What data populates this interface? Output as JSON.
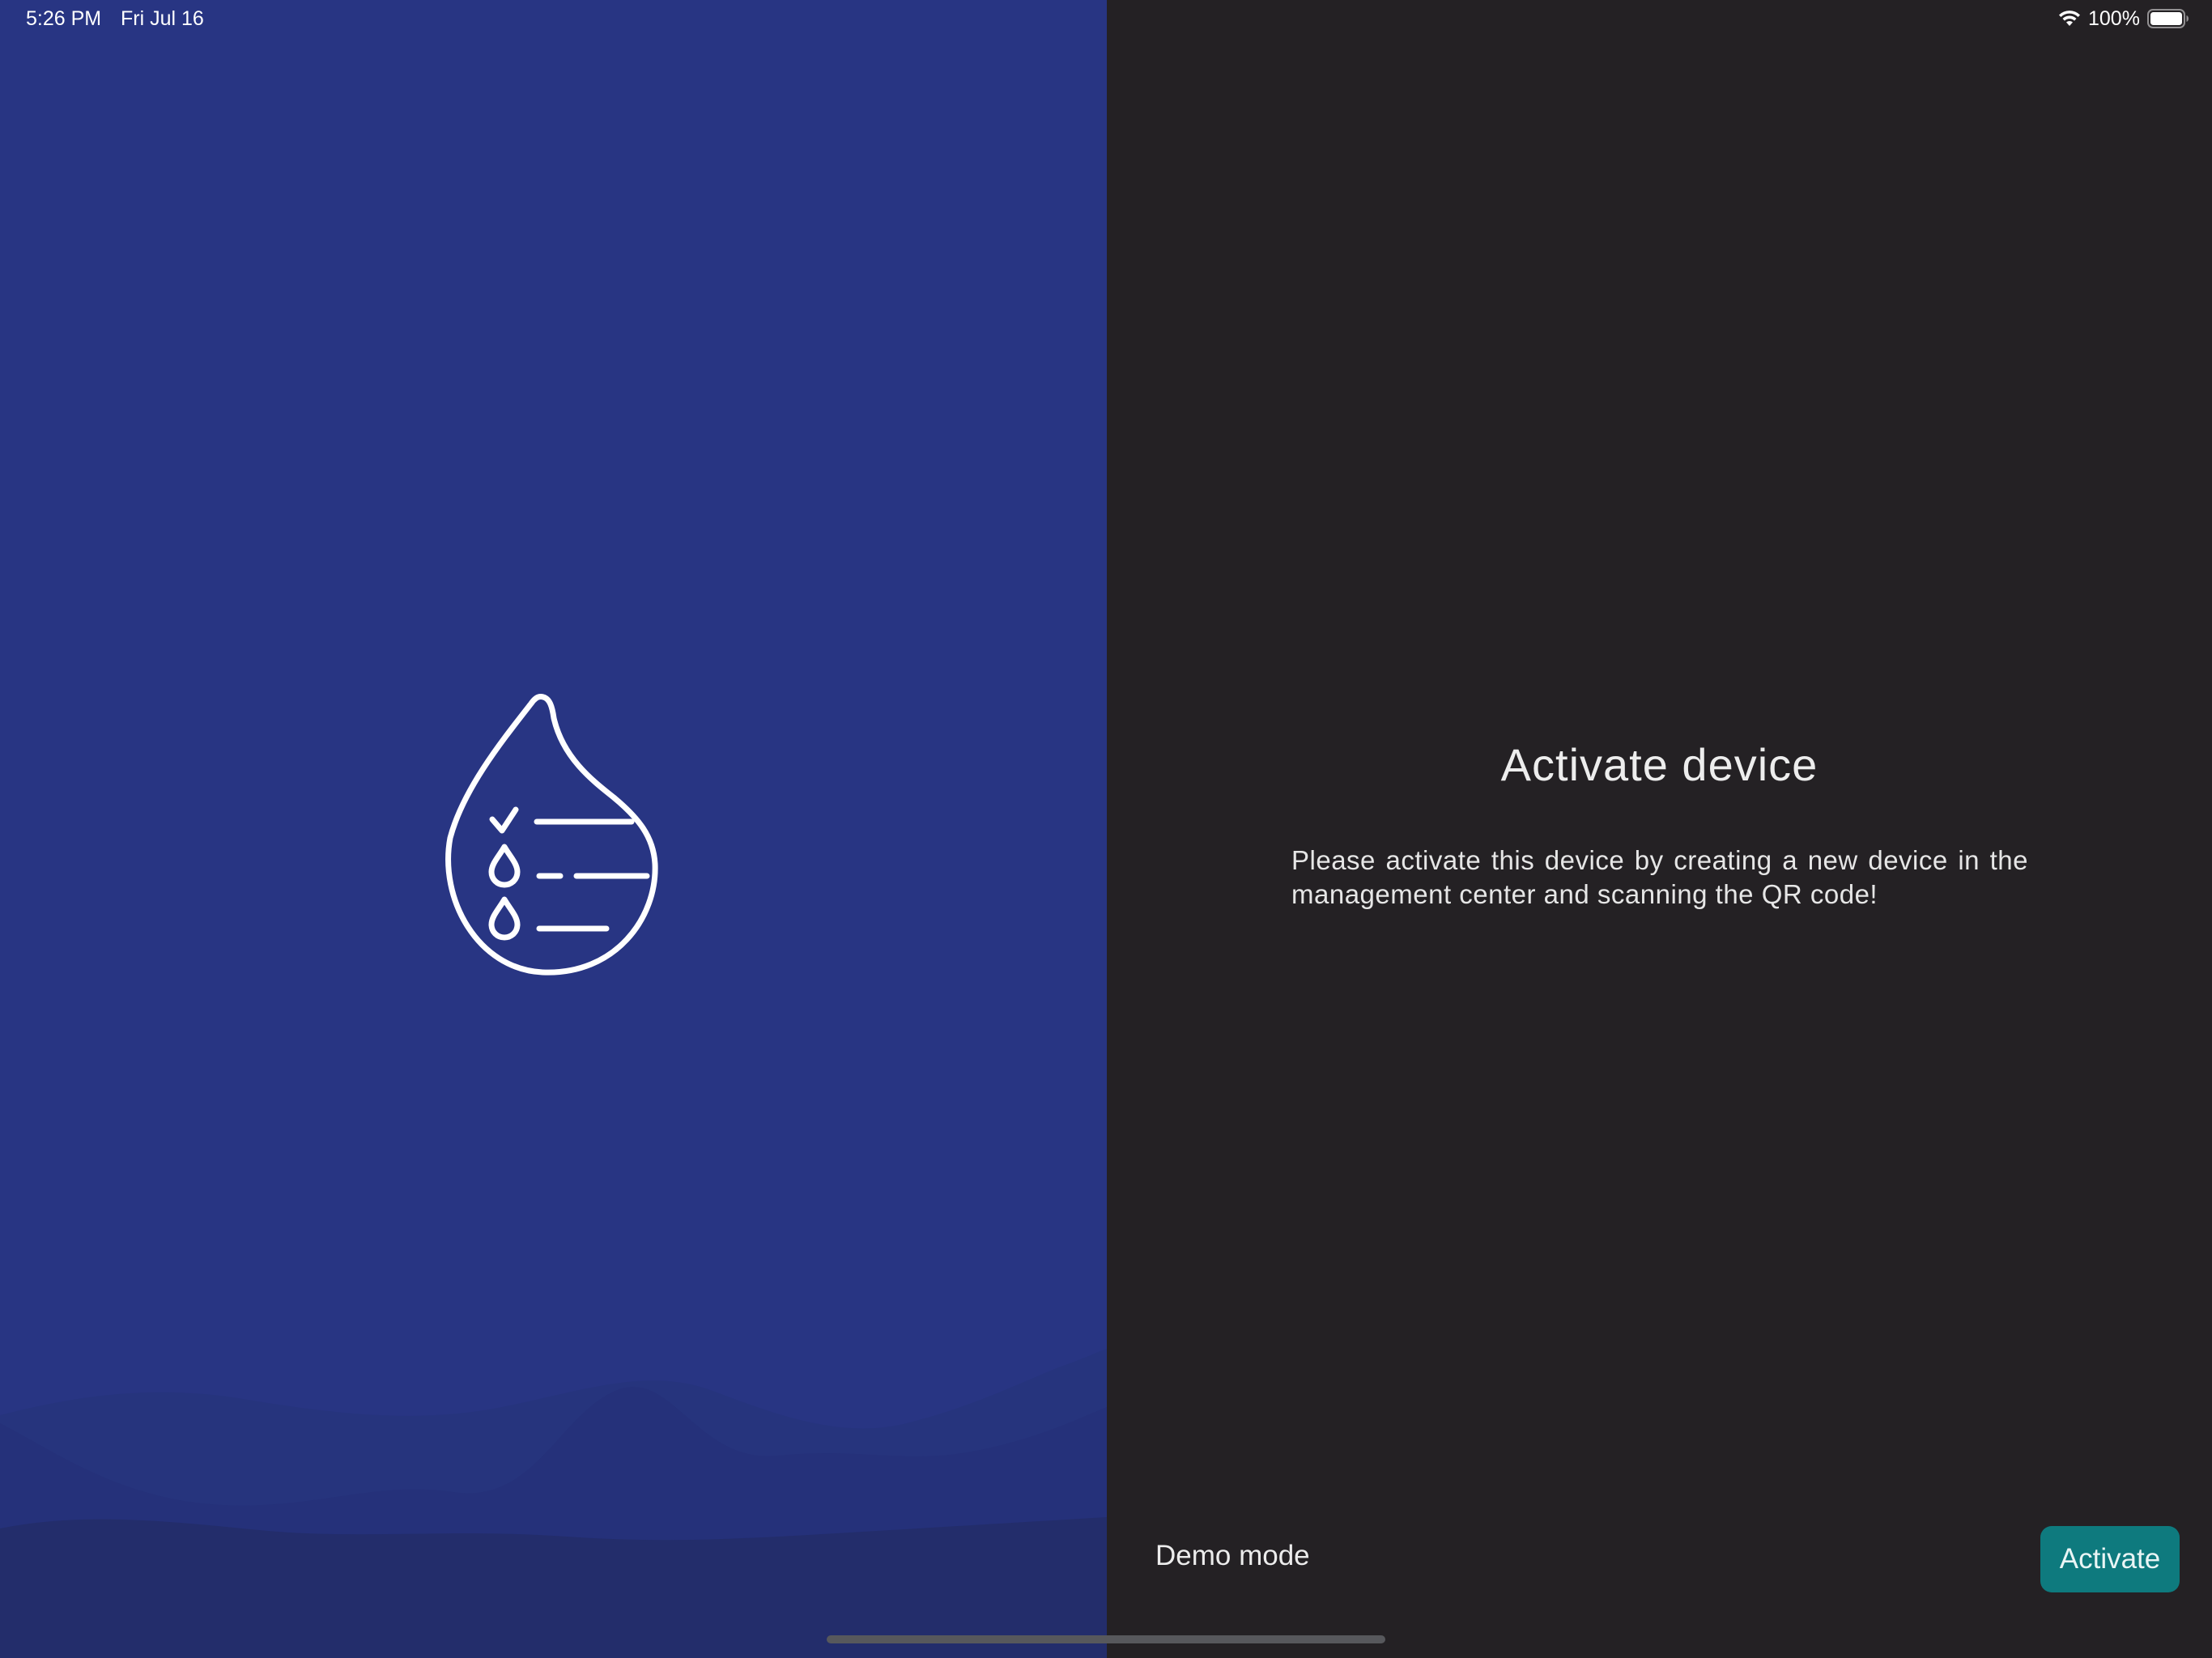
{
  "status_bar": {
    "time": "5:26 PM",
    "date": "Fri Jul 16",
    "battery_percent": "100%",
    "wifi_icon": "wifi-icon",
    "battery_icon": "battery-full-icon"
  },
  "brand": {
    "logo_icon": "water-drop-checklist-icon",
    "background_color": "#283583"
  },
  "activation": {
    "title": "Activate device",
    "description": "Please activate this device by creating a new device in the management center and scanning the QR code!",
    "demo_label": "Demo mode",
    "activate_label": "Activate",
    "accent_color": "#0e7a7e"
  }
}
